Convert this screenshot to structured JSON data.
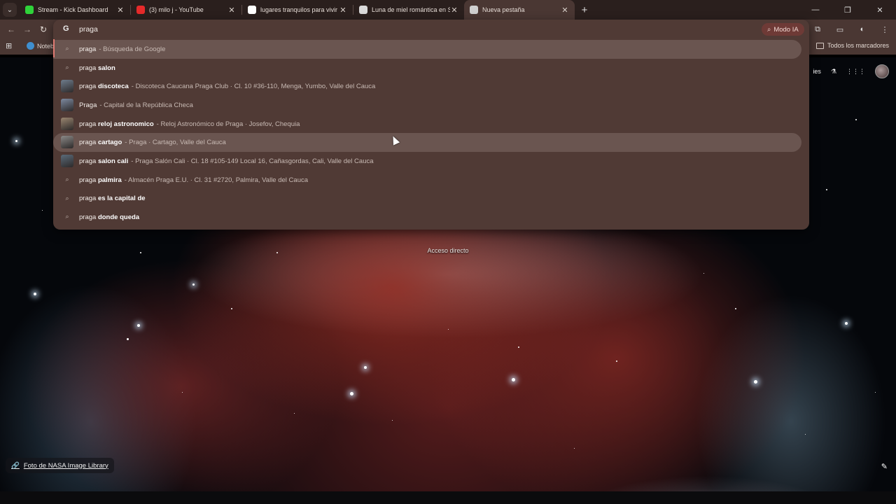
{
  "tabs": [
    {
      "title": "Stream - Kick Dashboard",
      "favicon": "kick-icon",
      "color": "#2fd33a",
      "active": false
    },
    {
      "title": "(3) milo j - YouTube",
      "favicon": "youtube-icon",
      "color": "#e62a2a",
      "active": false
    },
    {
      "title": "lugares tranquilos para vivir en",
      "favicon": "google-icon",
      "color": "#ffffff",
      "active": false
    },
    {
      "title": "Luna de miel romántica en Suiz",
      "favicon": "site-icon",
      "color": "#d9d9d9",
      "active": false
    },
    {
      "title": "Nueva pestaña",
      "favicon": "chrome-icon",
      "color": "#cfcfcf",
      "active": true
    }
  ],
  "omnibox": {
    "engine_glyph": "G",
    "query": "praga",
    "ai_mode_label": "Modo IA"
  },
  "suggestions": [
    {
      "kind": "search",
      "q": "praga",
      "bold": "",
      "detail": "- Búsqueda de Google",
      "style": "hl"
    },
    {
      "kind": "search",
      "q": "praga",
      "bold": "salon",
      "detail": "",
      "style": ""
    },
    {
      "kind": "place",
      "q": "praga",
      "bold": "discoteca",
      "detail": "- Discoteca Caucana Praga Club · Cl. 10 #36-110, Menga, Yumbo, Valle del Cauca",
      "style": "",
      "thumb": "#6f7d8d"
    },
    {
      "kind": "place",
      "q": "Praga",
      "bold": "",
      "detail": "- Capital de la República Checa",
      "style": "",
      "thumb": "#7d8aa0"
    },
    {
      "kind": "place",
      "q": "praga",
      "bold": "reloj astronomico",
      "detail": "- Reloj Astronómico de Praga · Josefov, Chequia",
      "style": "",
      "thumb": "#9a8670"
    },
    {
      "kind": "place",
      "q": "praga",
      "bold": "cartago",
      "detail": "- Praga · Cartago, Valle del Cauca",
      "style": "hl2",
      "thumb": "#8c8a88"
    },
    {
      "kind": "place",
      "q": "praga",
      "bold": "salon cali",
      "detail": "- Praga Salón Cali · Cl. 18 #105-149 Local 16, Cañasgordas, Cali, Valle del Cauca",
      "style": "",
      "thumb": "#5b6b7a"
    },
    {
      "kind": "search",
      "q": "praga",
      "bold": "palmira",
      "detail": "- Almacén Praga E.U. · Cl. 31 #2720, Palmira, Valle del Cauca",
      "style": ""
    },
    {
      "kind": "search",
      "q": "praga",
      "bold": "es la capital de",
      "detail": "",
      "style": ""
    },
    {
      "kind": "search",
      "q": "praga",
      "bold": "donde queda",
      "detail": "",
      "style": ""
    }
  ],
  "bookmarks": {
    "first": "Noteb",
    "all_label": "Todos los marcadores"
  },
  "ntp": {
    "partial_label": "ies",
    "shortcut_label": "Acceso directo",
    "credit_label": "Foto de NASA Image Library"
  }
}
